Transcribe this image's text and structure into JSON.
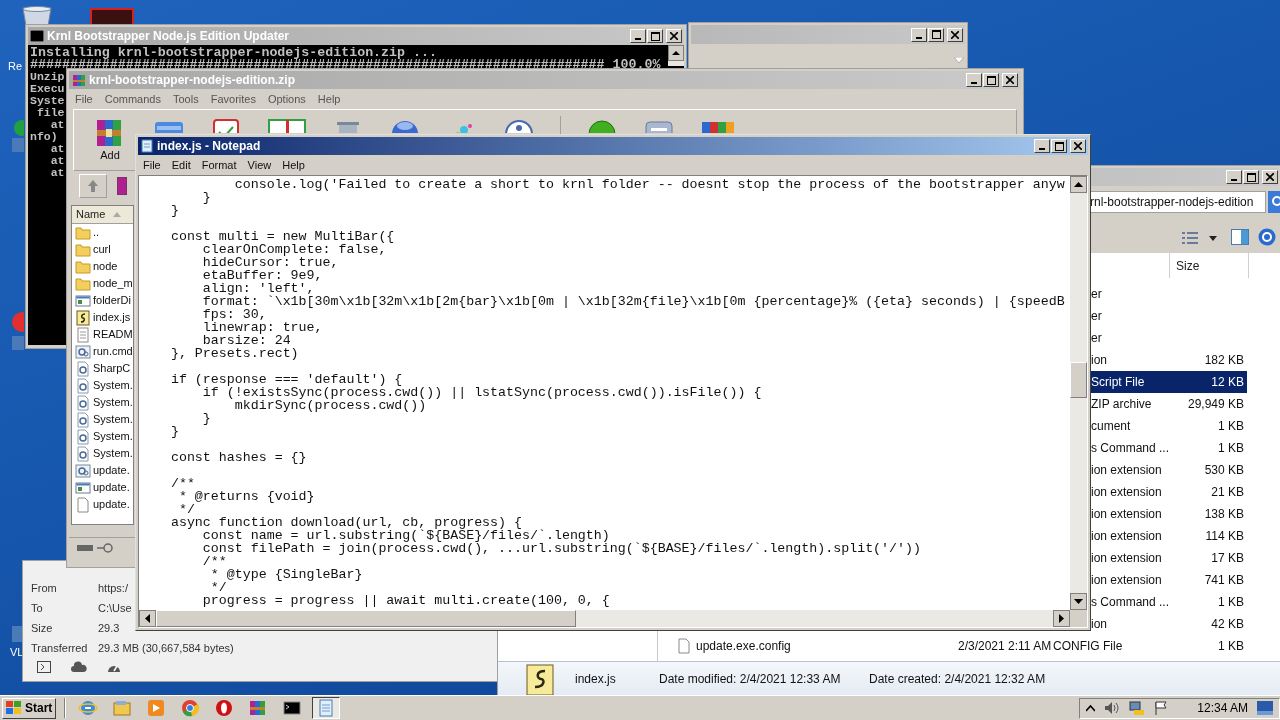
{
  "desktop": {
    "icon_labels": [
      "Re",
      "VL"
    ]
  },
  "console_window": {
    "title": "Krnl Bootstrapper Node.js Edition Updater",
    "lines": [
      "Installing krnl-bootstrapper-nodejs-edition.zip ...",
      "######################################################################## 100.0%",
      "Unzip",
      "Execu",
      "Syste",
      " file",
      "   at",
      "nfo)",
      "   at",
      "   at",
      "   at"
    ]
  },
  "archiver_window": {
    "title": "krnl-bootstrapper-nodejs-edition.zip",
    "menu": [
      "File",
      "Commands",
      "Tools",
      "Favorites",
      "Options",
      "Help"
    ],
    "add_label": "Add",
    "name_column": "Name",
    "files": [
      {
        "kind": "folder",
        "name": ".."
      },
      {
        "kind": "folder",
        "name": "curl"
      },
      {
        "kind": "folder",
        "name": "node"
      },
      {
        "kind": "folder",
        "name": "node_m"
      },
      {
        "kind": "app",
        "name": "folderDi"
      },
      {
        "kind": "script",
        "name": "index.js"
      },
      {
        "kind": "text",
        "name": "READM"
      },
      {
        "kind": "gear",
        "name": "run.cmd"
      },
      {
        "kind": "dll",
        "name": "SharpC"
      },
      {
        "kind": "dll",
        "name": "System."
      },
      {
        "kind": "dll",
        "name": "System."
      },
      {
        "kind": "dll",
        "name": "System."
      },
      {
        "kind": "dll",
        "name": "System."
      },
      {
        "kind": "dll",
        "name": "System."
      },
      {
        "kind": "gear",
        "name": "update."
      },
      {
        "kind": "app",
        "name": "update."
      },
      {
        "kind": "blank",
        "name": "update."
      }
    ]
  },
  "notepad": {
    "title": "index.js - Notepad",
    "menu": [
      "File",
      "Edit",
      "Format",
      "View",
      "Help"
    ],
    "code_blocks": [
      "            console.log('Failed to create a short to krnl folder -- doesnt stop the process of the bootstrapper anyw\n        }\n    }",
      "    const multi = new MultiBar({\n        clearOnComplete: false,\n        hideCursor: true,\n        etaBuffer: 9e9,\n        align: 'left',\n        format: `\\x1b[30m\\x1b[32m\\x1b[2m{bar}\\x1b[0m | \\x1b[32m{file}\\x1b[0m {percentage}% ({eta} seconds) | {speedB\n        fps: 30,\n        linewrap: true,\n        barsize: 24\n    }, Presets.rect)",
      "    if (response === 'default') {\n        if (!existsSync(process.cwd()) || lstatSync(process.cwd()).isFile()) {\n            mkdirSync(process.cwd())\n        }\n    }",
      "    const hashes = {}",
      "    /**\n     * @returns {void}\n     */\n    async function download(url, cb, progress) {\n        const name = url.substring(`${BASE}/files/`.length)\n        const filePath = join(process.cwd(), ...url.substring(`${BASE}/files/`.length).split('/'))\n        /**\n         * @type {SingleBar}\n         */\n        progress = progress || await multi.create(100, 0, {"
    ]
  },
  "download_dialog": {
    "fields": [
      {
        "label": "From",
        "value": "https:/"
      },
      {
        "label": "To",
        "value": "C:\\Use"
      },
      {
        "label": "Size",
        "value": "29.3"
      },
      {
        "label": "Transferred",
        "value": "29.3 MB (30,667,584 bytes)"
      }
    ]
  },
  "explorer": {
    "address": "rnl-bootstrapper-nodejs-edition",
    "size_column": "Size",
    "rows": [
      {
        "type": "er",
        "selected": false
      },
      {
        "type": "er",
        "selected": false
      },
      {
        "type": "er",
        "selected": false
      },
      {
        "type": "ion",
        "size": "182 KB",
        "selected": false
      },
      {
        "type": "Script File",
        "size": "12 KB",
        "selected": true
      },
      {
        "type": "ZIP archive",
        "size": "29,949 KB",
        "selected": false
      },
      {
        "type": "cument",
        "size": "1 KB",
        "selected": false
      },
      {
        "type": "s Command ...",
        "size": "1 KB",
        "selected": false
      },
      {
        "type": "ion extension",
        "size": "530 KB",
        "selected": false
      },
      {
        "type": "ion extension",
        "size": "21 KB",
        "selected": false
      },
      {
        "type": "ion extension",
        "size": "138 KB",
        "selected": false
      },
      {
        "type": "ion extension",
        "size": "114 KB",
        "selected": false
      },
      {
        "type": "ion extension",
        "size": "17 KB",
        "selected": false
      },
      {
        "type": "ion extension",
        "size": "741 KB",
        "selected": false
      },
      {
        "type": "s Command ...",
        "size": "1 KB",
        "selected": false
      },
      {
        "type": "ion",
        "size": "42 KB",
        "selected": false
      }
    ],
    "last_row": {
      "name": "update.exe.config",
      "date": "2/3/2021 2:11 AM",
      "type": "CONFIG File",
      "size": "1 KB"
    },
    "details": {
      "name": "index.js",
      "modified": "Date modified: 2/4/2021 12:33 AM",
      "created": "Date created: 2/4/2021 12:32 AM"
    }
  },
  "taskbar": {
    "start": "Start",
    "apps": [
      {
        "kind": "ie",
        "selected": false
      },
      {
        "kind": "explorer",
        "selected": false
      },
      {
        "kind": "media",
        "selected": false
      },
      {
        "kind": "chrome",
        "selected": false
      },
      {
        "kind": "opera",
        "selected": false
      },
      {
        "kind": "winrar",
        "selected": false
      },
      {
        "kind": "cmd",
        "selected": false
      },
      {
        "kind": "notepad",
        "selected": true
      }
    ],
    "clock": "12:34 AM"
  }
}
